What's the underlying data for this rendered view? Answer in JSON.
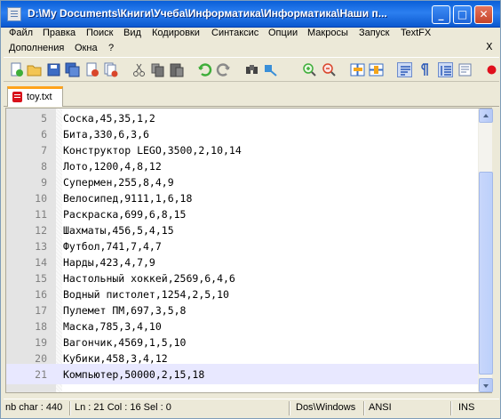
{
  "window": {
    "title": "D:\\My Documents\\Книги\\Учеба\\Информатика\\Информатика\\Наши п...",
    "minimize": "_",
    "maximize": "□",
    "close": "✕"
  },
  "menu": {
    "items": [
      "Файл",
      "Правка",
      "Поиск",
      "Вид",
      "Кодировки",
      "Синтаксис",
      "Опции",
      "Макросы",
      "Запуск",
      "TextFX",
      "Дополнения",
      "Окна",
      "?"
    ],
    "close": "X"
  },
  "toolbar": {
    "icons": [
      "new-file-icon",
      "open-file-icon",
      "save-icon",
      "save-all-icon",
      "close-icon",
      "print-icon",
      "cut-icon",
      "copy-icon",
      "paste-icon",
      "undo-icon",
      "redo-icon",
      "find-icon",
      "replace-icon",
      "zoom-in-icon",
      "zoom-out-icon",
      "sync-vertical-icon",
      "sync-horizontal-icon",
      "word-wrap-icon",
      "show-all-chars-icon",
      "indent-guide-icon",
      "record-macro-icon"
    ]
  },
  "tabs": [
    {
      "label": "toy.txt"
    }
  ],
  "editor": {
    "current_line": 21,
    "lines": [
      {
        "num": "5",
        "text": "Соска,45,35,1,2"
      },
      {
        "num": "6",
        "text": "Бита,330,6,3,6"
      },
      {
        "num": "7",
        "text": "Конструктор LEGO,3500,2,10,14"
      },
      {
        "num": "8",
        "text": "Лото,1200,4,8,12"
      },
      {
        "num": "9",
        "text": "Супермен,255,8,4,9"
      },
      {
        "num": "10",
        "text": "Велосипед,9111,1,6,18"
      },
      {
        "num": "11",
        "text": "Раскраска,699,6,8,15"
      },
      {
        "num": "12",
        "text": "Шахматы,456,5,4,15"
      },
      {
        "num": "13",
        "text": "Футбол,741,7,4,7"
      },
      {
        "num": "14",
        "text": "Нарды,423,4,7,9"
      },
      {
        "num": "15",
        "text": "Настольный хоккей,2569,6,4,6"
      },
      {
        "num": "16",
        "text": "Водный пистолет,1254,2,5,10"
      },
      {
        "num": "17",
        "text": "Пулемет ПМ,697,3,5,8"
      },
      {
        "num": "18",
        "text": "Маска,785,3,4,10"
      },
      {
        "num": "19",
        "text": "Вагончик,4569,1,5,10"
      },
      {
        "num": "20",
        "text": "Кубики,458,3,4,12"
      },
      {
        "num": "21",
        "text": "Компьютер,50000,2,15,18"
      }
    ]
  },
  "status": {
    "nb_char": "nb char : 440",
    "position": "Ln : 21   Col : 16   Sel : 0",
    "eol": "Dos\\Windows",
    "encoding": "ANSI",
    "mode": "INS"
  }
}
